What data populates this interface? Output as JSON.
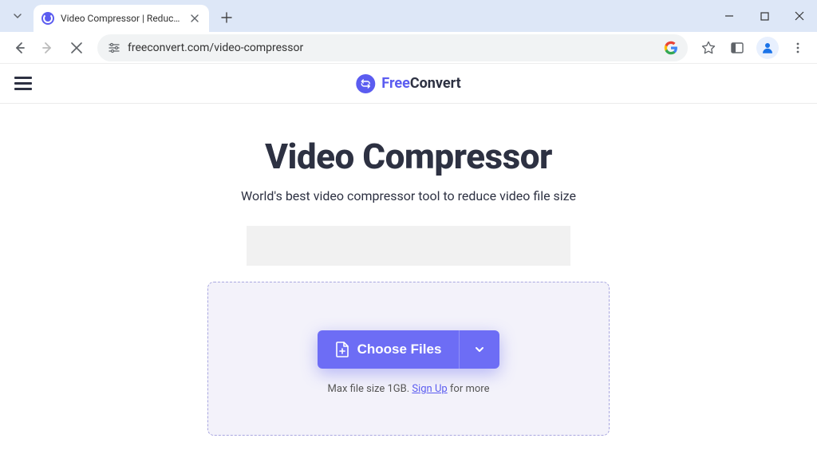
{
  "browser": {
    "tab_title": "Video Compressor | Reduce V",
    "url": "freeconvert.com/video-compressor"
  },
  "header": {
    "logo_free": "Free",
    "logo_convert": "Convert"
  },
  "main": {
    "title": "Video Compressor",
    "subtitle": "World's best video compressor tool to reduce video file size",
    "choose_label": "Choose Files",
    "max_size_prefix": "Max file size 1GB. ",
    "signup_label": "Sign Up",
    "max_size_suffix": " for more"
  }
}
